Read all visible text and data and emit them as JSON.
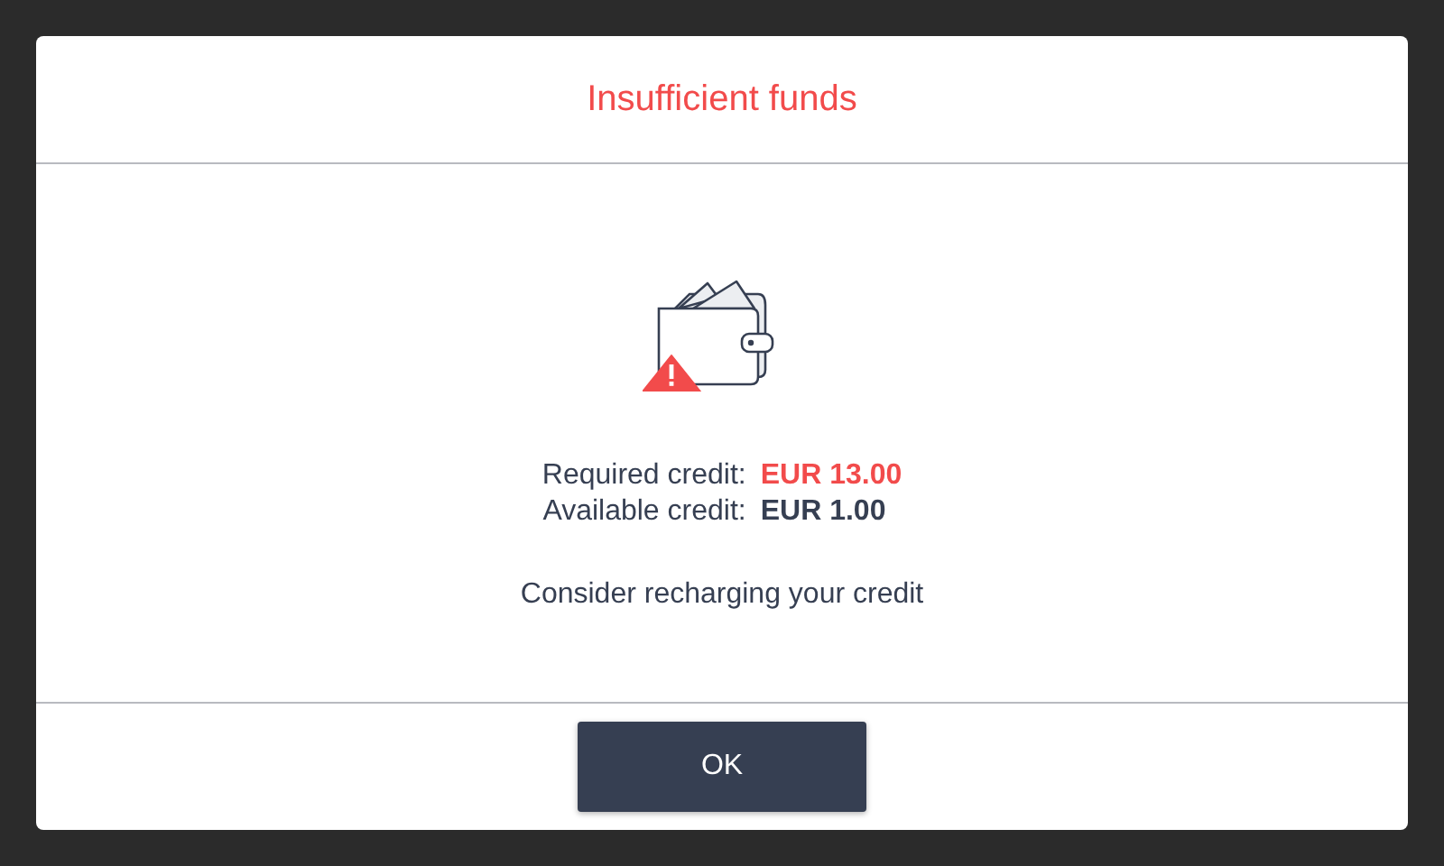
{
  "dialog": {
    "title": "Insufficient funds",
    "credits": [
      {
        "label": "Required credit:",
        "value": "EUR 13.00",
        "color": "#f24b4b"
      },
      {
        "label": "Available credit:",
        "value": "EUR 1.00",
        "color": "#363f52"
      }
    ],
    "message": "Consider recharging your credit",
    "buttons": [
      "OK"
    ]
  }
}
